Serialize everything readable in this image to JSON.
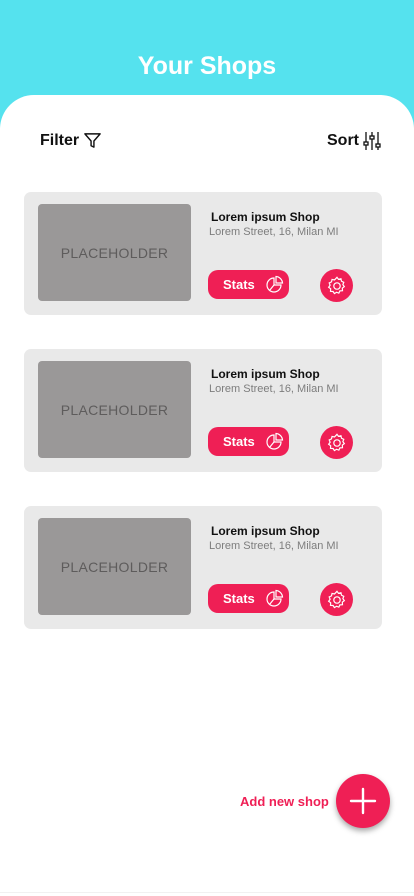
{
  "header": {
    "title": "Your Shops"
  },
  "toolbar": {
    "filter_label": "Filter",
    "filter_icon": "funnel-icon",
    "sort_label": "Sort",
    "sort_icon": "sliders-icon"
  },
  "shops": [
    {
      "image_label": "PLACEHOLDER",
      "name": "Lorem ipsum Shop",
      "address": "Lorem Street, 16, Milan MI",
      "stats_label": "Stats"
    },
    {
      "image_label": "PLACEHOLDER",
      "name": "Lorem ipsum Shop",
      "address": "Lorem Street, 16, Milan MI",
      "stats_label": "Stats"
    },
    {
      "image_label": "PLACEHOLDER",
      "name": "Lorem ipsum Shop",
      "address": "Lorem Street, 16, Milan MI",
      "stats_label": "Stats"
    }
  ],
  "add_shop": {
    "label": "Add new shop",
    "icon": "plus-icon"
  },
  "colors": {
    "header_bg": "#55e2ee",
    "accent": "#ef1f55",
    "card_bg": "#e9e9e9",
    "placeholder_bg": "#9a9898"
  }
}
